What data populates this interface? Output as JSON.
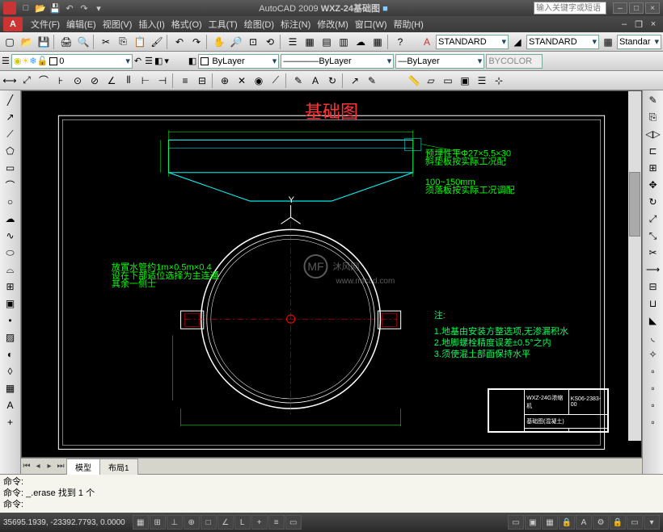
{
  "app": {
    "name": "AutoCAD 2009",
    "doc_title": "WXZ-24基础图",
    "search_placeholder": "输入关键字或短语"
  },
  "menu": {
    "items": [
      "文件(F)",
      "编辑(E)",
      "视图(V)",
      "插入(I)",
      "格式(O)",
      "工具(T)",
      "绘图(D)",
      "标注(N)",
      "修改(M)",
      "窗口(W)",
      "帮助(H)"
    ]
  },
  "layers": {
    "current": "0"
  },
  "props": {
    "layer_color": "ByLayer",
    "linetype": "ByLayer",
    "lineweight": "ByLayer",
    "plotstyle": "BYCOLOR"
  },
  "styles": {
    "text": "STANDARD",
    "dim": "STANDARD",
    "table": "Standar"
  },
  "tabs": {
    "items": [
      "模型",
      "布局1"
    ],
    "active": 0
  },
  "cmd": {
    "l1": "命令:",
    "l2": "命令: _.erase 找到 1 个",
    "l3": "命令:"
  },
  "status": {
    "coords": "35695.1939, -23392.7793, 0.0000"
  },
  "drawing": {
    "title": "基础图",
    "watermark": "沐风网",
    "watermark_url": "www.mfcad.com",
    "notes_header": "注:",
    "notes": [
      "1.地基由安装方整选项,无渗漏积水",
      "2.地脚螺栓精度误差±0.5°之内",
      "3.须使混土部面保持水平"
    ],
    "titleblock": {
      "product": "WXZ-24G浓缩机",
      "code": "KS06-2383-00",
      "name": "基础图(混凝土)"
    }
  }
}
